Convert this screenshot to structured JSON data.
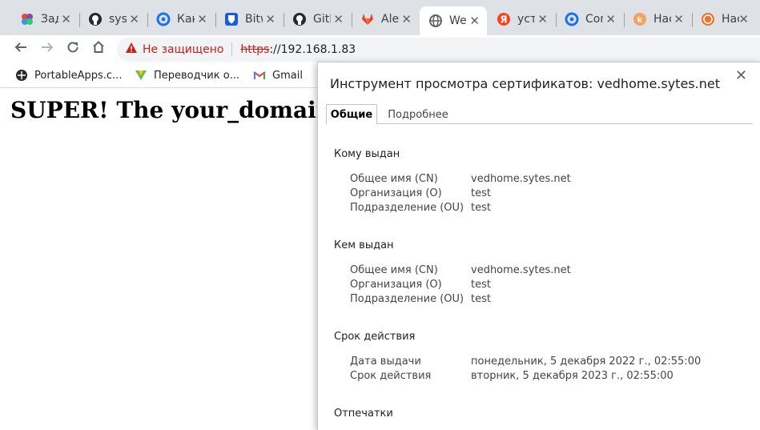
{
  "tabs": [
    {
      "title": "Задачи",
      "icon": "multicolor-dots-icon"
    },
    {
      "title": "sys",
      "icon": "github-icon"
    },
    {
      "title": "Как",
      "icon": "cloud-blue-icon"
    },
    {
      "title": "Bitwarden",
      "icon": "bitwarden-shield-icon"
    },
    {
      "title": "GitHub",
      "icon": "github-icon"
    },
    {
      "title": "Alex",
      "icon": "gitlab-icon"
    },
    {
      "title": "Welcome",
      "icon": "globe-icon"
    },
    {
      "title": "устройство",
      "icon": "yandex-icon"
    },
    {
      "title": "Con",
      "icon": "cloud-blue-icon"
    },
    {
      "title": "Настройки",
      "icon": "orange-circle-icon"
    },
    {
      "title": "Настройки",
      "icon": "orange-dm-icon"
    }
  ],
  "toolbar": {
    "security_warning": "Не защищено",
    "url_scheme": "https",
    "url_rest": "://192.168.1.83"
  },
  "bookmarks": [
    {
      "label": "PortableApps.c...",
      "icon": "portableapps-icon"
    },
    {
      "label": "Переводчик о...",
      "icon": "translator-icon"
    },
    {
      "label": "Gmail",
      "icon": "gmail-icon"
    }
  ],
  "page": {
    "heading": "SUPER! The your_domain works!"
  },
  "dialog": {
    "title": "Инструмент просмотра сертификатов: vedhome.sytes.net",
    "tabs": [
      "Общие",
      "Подробнее"
    ],
    "issued_to": {
      "title": "Кому выдан",
      "rows": [
        {
          "label": "Общее имя (CN)",
          "value": "vedhome.sytes.net"
        },
        {
          "label": "Организация (O)",
          "value": "test"
        },
        {
          "label": "Подразделение (OU)",
          "value": "test"
        }
      ]
    },
    "issued_by": {
      "title": "Кем выдан",
      "rows": [
        {
          "label": "Общее имя (CN)",
          "value": "vedhome.sytes.net"
        },
        {
          "label": "Организация (O)",
          "value": "test"
        },
        {
          "label": "Подразделение (OU)",
          "value": "test"
        }
      ]
    },
    "validity": {
      "title": "Срок действия",
      "rows": [
        {
          "label": "Дата выдачи",
          "value": "понедельник, 5 декабря 2022 г., 02:55:00"
        },
        {
          "label": "Срок действия",
          "value": "вторник, 5 декабря 2023 г., 02:55:00"
        }
      ]
    },
    "fingerprints": {
      "title": "Отпечатки"
    }
  }
}
